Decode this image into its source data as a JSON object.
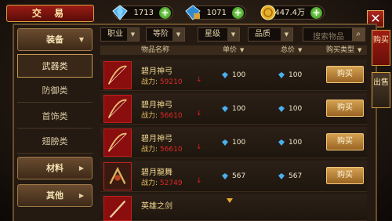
{
  "window": {
    "title": "交 易"
  },
  "currencies": [
    {
      "icon": "diamond-icon",
      "value": "1713"
    },
    {
      "icon": "bound-diamond-icon",
      "value": "1071"
    },
    {
      "icon": "gold-coin-icon",
      "value": "447.4万"
    }
  ],
  "side_tabs": [
    {
      "label": "购买"
    },
    {
      "label": "出售"
    }
  ],
  "categories": {
    "equipment": {
      "label": "装备"
    },
    "materials": {
      "label": "材料"
    },
    "other": {
      "label": "其他"
    },
    "subs": [
      {
        "label": "武器类"
      },
      {
        "label": "防御类"
      },
      {
        "label": "首饰类"
      },
      {
        "label": "翅膀类"
      }
    ]
  },
  "filters": [
    {
      "label": "职业"
    },
    {
      "label": "等阶"
    },
    {
      "label": "星级"
    },
    {
      "label": "品质"
    }
  ],
  "search": {
    "placeholder": "搜索物品"
  },
  "table": {
    "headers": {
      "name": "物品名称",
      "unit_price": "单价",
      "total_price": "总价",
      "buy_type": "购买类型"
    },
    "power_label": "战力:",
    "rows": [
      {
        "name": "碧月神弓",
        "power": "59210",
        "unit_price": "100",
        "total_price": "100",
        "buy_label": "购买"
      },
      {
        "name": "碧月神弓",
        "power": "56610",
        "unit_price": "100",
        "total_price": "100",
        "buy_label": "购买"
      },
      {
        "name": "碧月神弓",
        "power": "56610",
        "unit_price": "100",
        "total_price": "100",
        "buy_label": "购买"
      },
      {
        "name": "碧月龍舞",
        "power": "52749",
        "unit_price": "567",
        "total_price": "567",
        "buy_label": "购买"
      },
      {
        "name": "英雄之剑",
        "power": "",
        "unit_price": "",
        "total_price": "",
        "buy_label": ""
      }
    ]
  },
  "colors": {
    "accent_red": "#9a1c14",
    "gold": "#d4a050",
    "power_red": "#e02828"
  }
}
